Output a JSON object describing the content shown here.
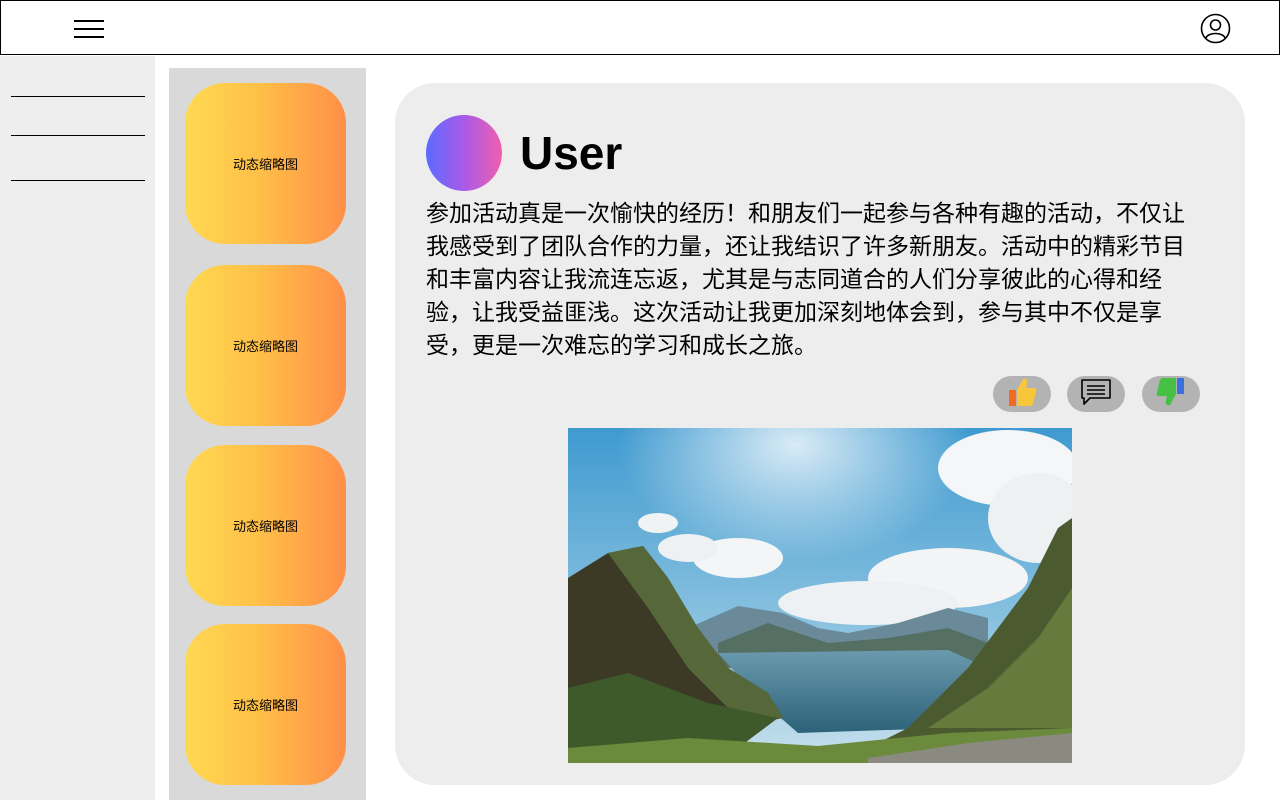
{
  "header": {
    "menu_icon": "hamburger-menu-icon",
    "profile_icon": "user-circle-icon"
  },
  "sidebar": {
    "items": [
      {
        "label": ""
      },
      {
        "label": ""
      },
      {
        "label": ""
      }
    ]
  },
  "thumbnails": [
    {
      "label": "动态缩略图"
    },
    {
      "label": "动态缩略图"
    },
    {
      "label": "动态缩略图"
    },
    {
      "label": "动态缩略图"
    }
  ],
  "post": {
    "username": "User",
    "text": "参加活动真是一次愉快的经历！和朋友们一起参与各种有趣的活动，不仅让我感受到了团队合作的力量，还让我结识了许多新朋友。活动中的精彩节目和丰富内容让我流连忘返，尤其是与志同道合的人们分享彼此的心得和经验，让我受益匪浅。这次活动让我更加深刻地体会到，参与其中不仅是享受，更是一次难忘的学习和成长之旅。",
    "actions": [
      {
        "icon": "thumbs-up-icon"
      },
      {
        "icon": "comment-icon"
      },
      {
        "icon": "thumbs-down-icon"
      }
    ],
    "image": "mountain-lake-photo"
  },
  "colors": {
    "thumb_gradient_start": "#ffd952",
    "thumb_gradient_end": "#ff8f48",
    "avatar_gradient_start": "#5b6bff",
    "avatar_gradient_end": "#f05fae",
    "card_bg": "#ededed",
    "sidebar_bg": "#eeeeee",
    "thumb_col_bg": "#d9d9d9"
  }
}
